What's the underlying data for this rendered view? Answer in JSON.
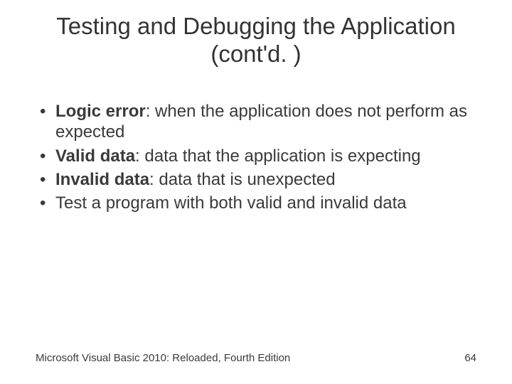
{
  "title": "Testing and Debugging the Application (cont'd. )",
  "bullets": [
    {
      "term": "Logic error",
      "underline": true,
      "rest": ": when the application does not perform as expected"
    },
    {
      "term": "Valid data",
      "underline": true,
      "rest": ": data that the application is expecting"
    },
    {
      "term": "Invalid data",
      "underline": true,
      "rest": ": data that is unexpected"
    },
    {
      "term": "",
      "underline": false,
      "rest": "Test a program with both valid and invalid data"
    }
  ],
  "footer": {
    "left": "Microsoft Visual Basic 2010: Reloaded, Fourth Edition",
    "page": "64"
  }
}
